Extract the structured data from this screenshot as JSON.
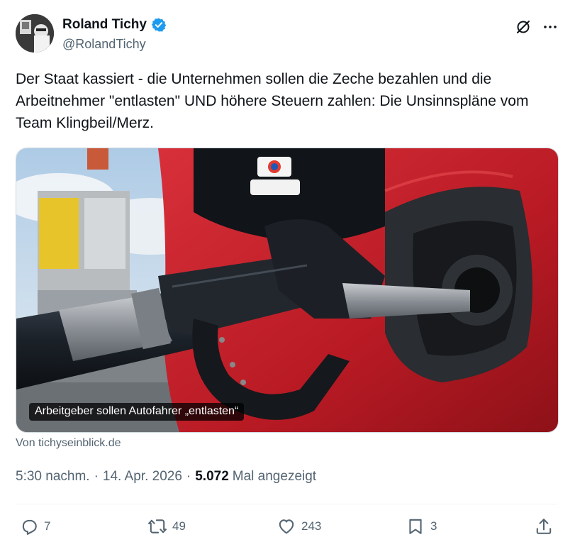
{
  "author": {
    "display_name": "Roland Tichy",
    "handle": "@RolandTichy",
    "verified": true
  },
  "tweet": {
    "text": "Der Staat kassiert - die Unternehmen sollen die Zeche bezahlen und die Arbeitnehmer \"entlasten\" UND höhere Steuern zahlen: Die Unsinnspläne vom Team Klingbeil/Merz."
  },
  "link_card": {
    "caption": "Arbeitgeber sollen Autofahrer „entlasten“",
    "source": "Von tichyseinblick.de"
  },
  "meta": {
    "time": "5:30 nachm.",
    "date": "14. Apr. 2026",
    "views_count": "5.072",
    "views_label": "Mal angezeigt",
    "separator": "·"
  },
  "actions": {
    "replies": "7",
    "reposts": "49",
    "likes": "243",
    "bookmarks": "3"
  },
  "colors": {
    "text": "#0f1419",
    "secondary": "#536471",
    "verified": "#1d9bf0",
    "car_red": "#c8202a"
  },
  "icons": [
    "verified-badge-icon",
    "grok-icon",
    "more-icon",
    "reply-icon",
    "repost-icon",
    "like-icon",
    "bookmark-icon",
    "share-icon"
  ]
}
